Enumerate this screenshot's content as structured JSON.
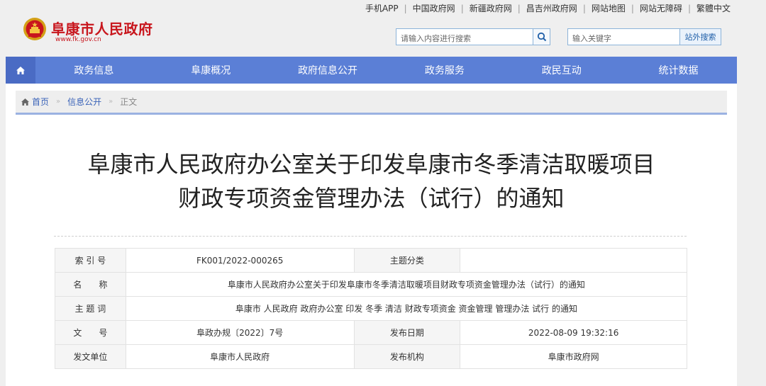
{
  "top_links": [
    "手机APP",
    "中国政府网",
    "新疆政府网",
    "昌吉州政府网",
    "网站地图",
    "网站无障碍",
    "繁體中文"
  ],
  "header": {
    "title": "阜康市人民政府",
    "url": "www.fk.gov.cn",
    "search_placeholder": "请输入内容进行搜索",
    "keyword_placeholder": "输入关键字",
    "external_search_label": "站外搜索"
  },
  "nav": {
    "items": [
      "政务信息",
      "阜康概况",
      "政府信息公开",
      "政务服务",
      "政民互动",
      "统计数据"
    ]
  },
  "breadcrumb": {
    "home": "首页",
    "level1": "信息公开",
    "current": "正文"
  },
  "article": {
    "title_line1": "阜康市人民政府办公室关于印发阜康市冬季清洁取暖项目",
    "title_line2": "财政专项资金管理办法（试行）的通知"
  },
  "meta": {
    "index_label": "索 引 号",
    "index_value": "FK001/2022-000265",
    "topic_label": "主题分类",
    "topic_value": "",
    "name_label": "名　　称",
    "name_value": "阜康市人民政府办公室关于印发阜康市冬季清洁取暖项目财政专项资金管理办法（试行）的通知",
    "keywords_label": "主 题 词",
    "keywords_value": "阜康市 人民政府 政府办公室 印发 冬季 清洁 财政专项资金 资金管理 管理办法 试行 的通知",
    "doc_no_label": "文　　号",
    "doc_no_value": "阜政办规〔2022〕7号",
    "pub_date_label": "发布日期",
    "pub_date_value": "2022-08-09 19:32:16",
    "issuer_label": "发文单位",
    "issuer_value": "阜康市人民政府",
    "publisher_label": "发布机构",
    "publisher_value": "阜康市政府网"
  },
  "colors": {
    "nav": "#5b7fd6",
    "brand_red": "#c8161d",
    "link": "#3a63b8"
  },
  "icons": [
    "search-icon",
    "home-icon",
    "emblem-logo"
  ]
}
